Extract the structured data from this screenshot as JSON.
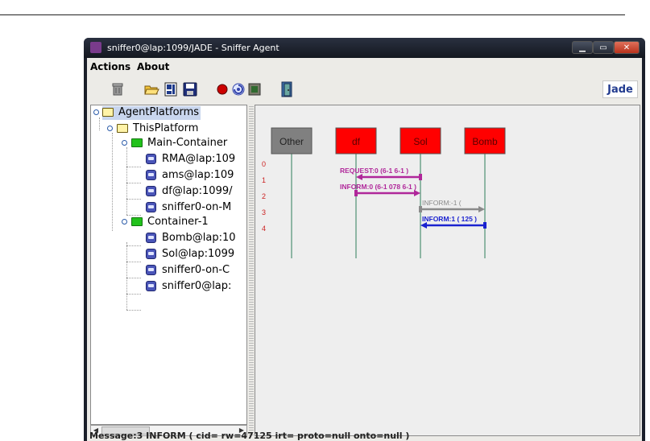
{
  "window": {
    "title": "sniffer0@lap:1099/JADE - Sniffer Agent",
    "controls": {
      "minimize": "▁",
      "maximize": "▭",
      "close": "✕"
    }
  },
  "menu": {
    "items": [
      "Actions",
      "About"
    ]
  },
  "toolbar": {
    "icons": [
      "trash-icon",
      "open-folder-icon",
      "save-as-icon",
      "save-icon",
      "record-icon",
      "sniff-icon",
      "stop-icon",
      "exit-door-icon"
    ],
    "logo": "Jade"
  },
  "tree": {
    "root": "AgentPlatforms",
    "platform": "ThisPlatform",
    "containers": [
      {
        "name": "Main-Container",
        "agents": [
          "RMA@lap:109",
          "ams@lap:109",
          "df@lap:1099/",
          "sniffer0-on-M"
        ]
      },
      {
        "name": "Container-1",
        "agents": [
          "Bomb@lap:10",
          "Sol@lap:1099",
          "sniffer0-on-C",
          "sniffer0@lap:"
        ]
      }
    ]
  },
  "sequence": {
    "agents": [
      {
        "name": "Other",
        "color": "#808080"
      },
      {
        "name": "df",
        "color": "#ff0000"
      },
      {
        "name": "Sol",
        "color": "#ff0000"
      },
      {
        "name": "Bomb",
        "color": "#ff0000"
      }
    ],
    "row_labels": [
      "0",
      "1",
      "2",
      "3",
      "4"
    ],
    "messages": [
      {
        "label": "REQUEST:0 (6-1  6-1   )",
        "from": 2,
        "to": 1,
        "color": "#b0279a"
      },
      {
        "label": "INFORM:0 (6-1  078  6-1 )",
        "from": 1,
        "to": 2,
        "color": "#b0279a"
      },
      {
        "label": "INFORM:-1 (         ",
        "from": 2,
        "to": 3,
        "color": "#8a8a8a"
      },
      {
        "label": "INFORM:1 (   125     )",
        "from": 3,
        "to": 2,
        "color": "#1a22d0"
      }
    ],
    "lifeline_color": "#2e7d5a",
    "row_label_color": "#cc2222"
  },
  "status": "Message:3 INFORM ( cid=  rw=47125 irt=  proto=null onto=null )"
}
